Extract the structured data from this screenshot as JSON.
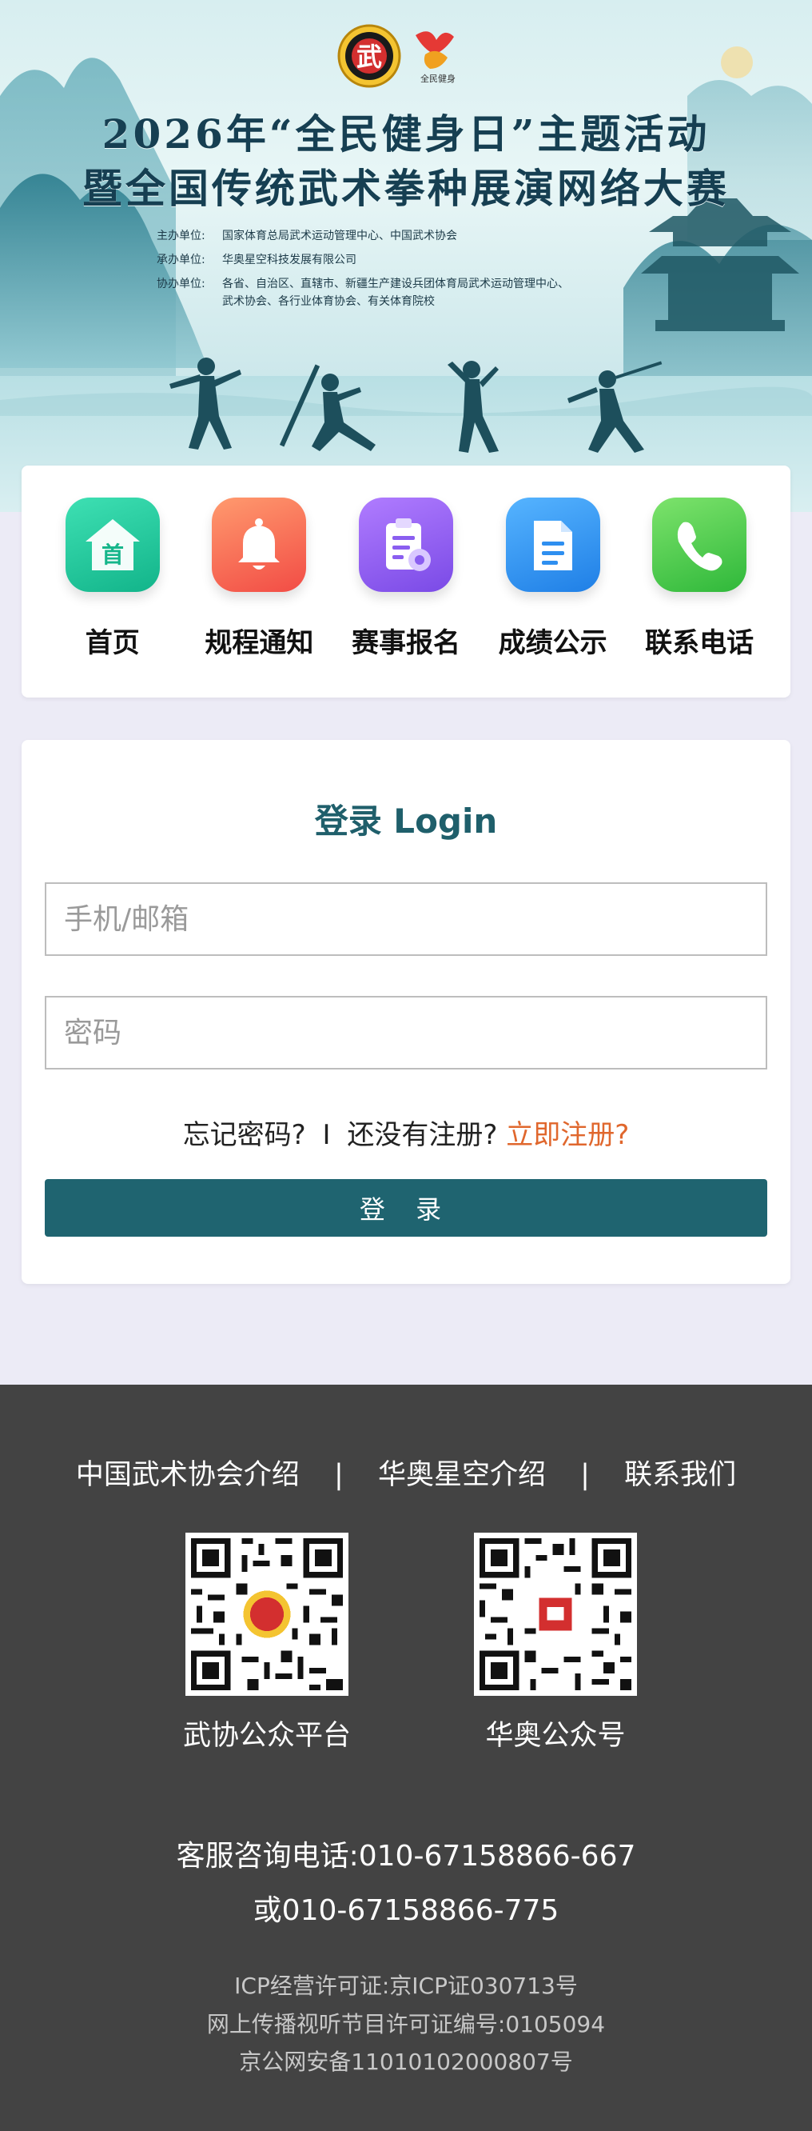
{
  "banner": {
    "title_line1": "2026年“全民健身日”主题活动",
    "title_line2": "暨全国传统武术拳种展演网络大赛",
    "logo_char": "武",
    "logo2_text": "全民健身",
    "organizers": [
      {
        "key": "主办单位:",
        "value": "国家体育总局武术运动管理中心、中国武术协会",
        "value2": ""
      },
      {
        "key": "承办单位:",
        "value": "华奥星空科技发展有限公司",
        "value2": ""
      },
      {
        "key": "协办单位:",
        "value": "各省、自治区、直辖市、新疆生产建设兵团体育局武术运动管理中心、",
        "value2": "武术协会、各行业体育协会、有关体育院校"
      }
    ]
  },
  "nav": {
    "items": [
      {
        "label": "首页",
        "icon": "home-icon",
        "color": "#1fc79a",
        "glyph": "首"
      },
      {
        "label": "规程通知",
        "icon": "bell-icon",
        "color": "#f66a4f"
      },
      {
        "label": "赛事报名",
        "icon": "clipboard-gear-icon",
        "color": "#8a5ef0"
      },
      {
        "label": "成绩公示",
        "icon": "document-icon",
        "color": "#2e8ff0"
      },
      {
        "label": "联系电话",
        "icon": "phone-icon",
        "color": "#3fc743"
      }
    ]
  },
  "login": {
    "title": "登录 Login",
    "username_placeholder": "手机/邮箱",
    "password_placeholder": "密码",
    "forgot": "忘记密码?",
    "divider": "I",
    "not_registered": "还没有注册?",
    "register": "立即注册?",
    "button": "登 录",
    "accent": "#1f6470",
    "register_color": "#e0672d"
  },
  "footer": {
    "links": [
      "中国武术协会介绍",
      "华奥星空介绍",
      "联系我们"
    ],
    "separator": "|",
    "qr": [
      {
        "label": "武协公众平台"
      },
      {
        "label": "华奥公众号"
      }
    ],
    "hotline1": "客服咨询电话:010-67158866-667",
    "hotline2": "或010-67158866-775",
    "license1": "ICP经营许可证:京ICP证030713号",
    "license2": "网上传播视听节目许可证编号:0105094",
    "license3": "京公网安备11010102000807号",
    "background": "#434343"
  }
}
